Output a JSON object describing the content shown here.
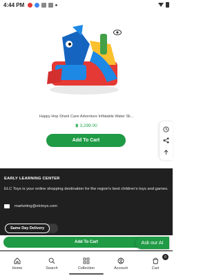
{
  "status_bar": {
    "time": "4:44",
    "time_suffix": "PM"
  },
  "product": {
    "title": "Happy Hop Shark Cave Adventure Inflatable Water Sli...",
    "currency_symbol": "฿",
    "price": "3,299.00",
    "add_to_cart_label": "Add To Cart"
  },
  "footer": {
    "heading": "EARLY LEARNING CENTER",
    "description": "ELC Toys is your online shopping destination for the region's best children's toys and games.",
    "email": "marketing@elctoys.com",
    "same_day_label": "Same Day Delivery"
  },
  "sticky": {
    "add_to_cart_label": "Add To Cart"
  },
  "ask_ai": {
    "label": "Ask our AI"
  },
  "bottom_nav": {
    "items": [
      {
        "label": "Home",
        "icon": "home-icon"
      },
      {
        "label": "Search",
        "icon": "search-icon"
      },
      {
        "label": "Collection",
        "icon": "grid-icon"
      },
      {
        "label": "Account",
        "icon": "account-icon"
      },
      {
        "label": "Cart",
        "icon": "cart-icon"
      }
    ],
    "cart_count": "0"
  },
  "colors": {
    "accent_green": "#1f9a45",
    "footer_bg": "#202020"
  }
}
